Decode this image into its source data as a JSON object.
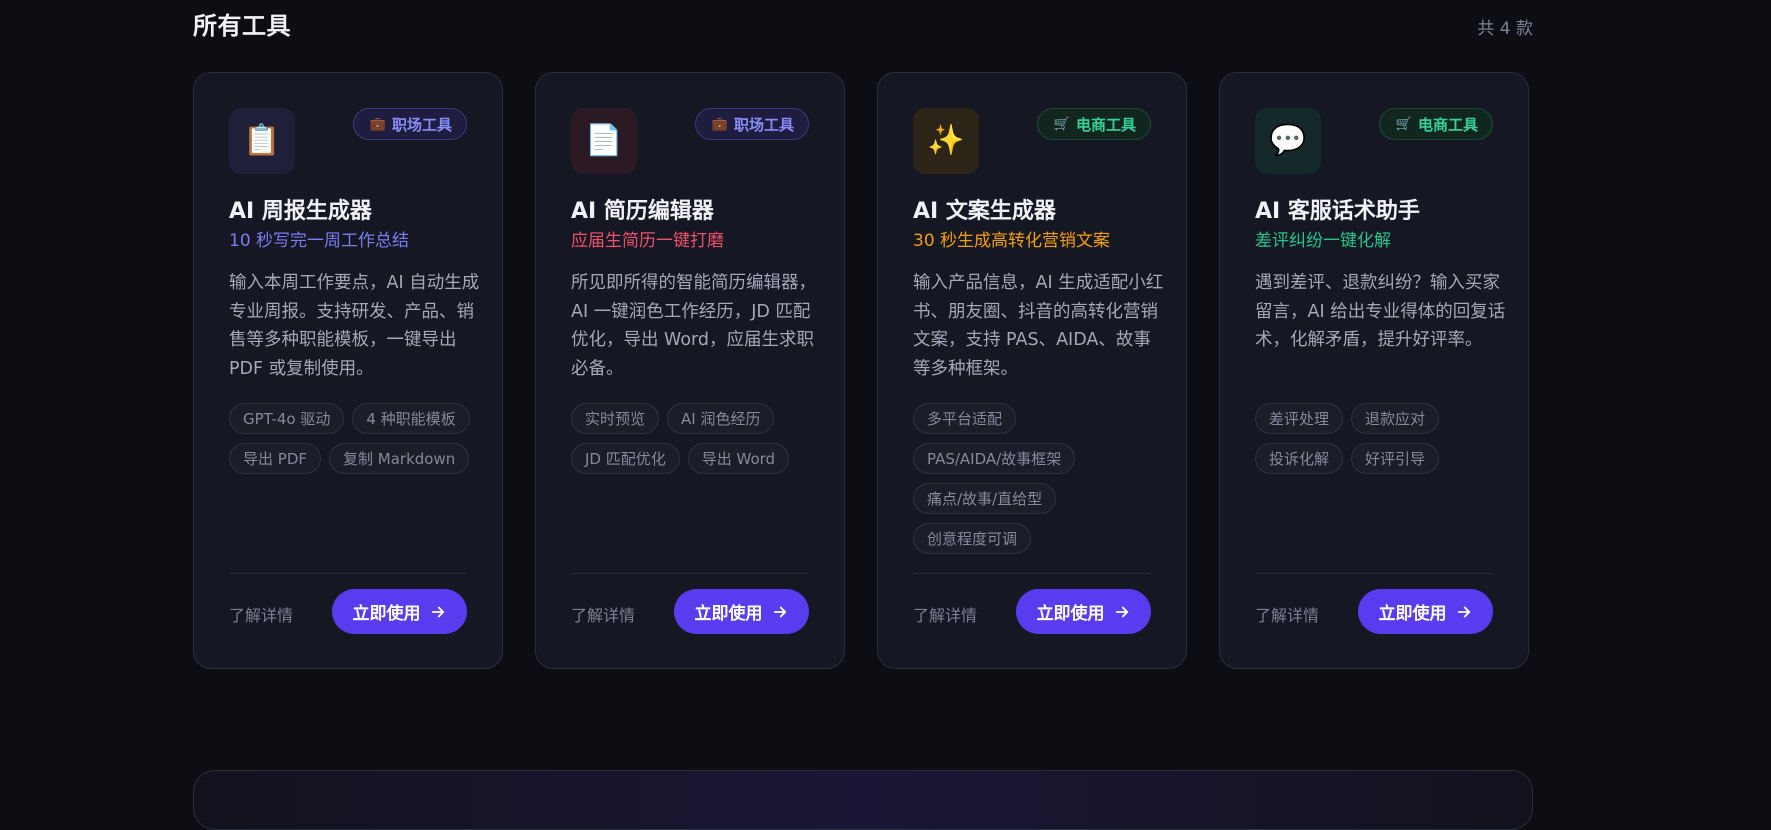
{
  "section": {
    "title": "所有工具",
    "count": "共 4 款"
  },
  "cards": [
    {
      "icon": "📋",
      "icon_name": "clipboard-icon",
      "icon_bg": "#1f1f3a",
      "badge": {
        "icon": "💼",
        "icon_name": "briefcase-icon",
        "label": "职场工具",
        "color": "#8b8cf7"
      },
      "title": "AI 周报生成器",
      "subtitle": "10 秒写完一周工作总结",
      "subtitle_color": "#7c7cf5",
      "description": "输入本周工作要点，AI 自动生成专业周报。支持研发、产品、销售等多种职能模板，一键导出 PDF 或复制使用。",
      "tags": [
        "GPT-4o 驱动",
        "4 种职能模板",
        "导出 PDF",
        "复制 Markdown"
      ],
      "learn_more": "了解详情",
      "cta": "立即使用"
    },
    {
      "icon": "📄",
      "icon_name": "document-icon",
      "icon_bg": "#2b1a24",
      "badge": {
        "icon": "💼",
        "icon_name": "briefcase-icon",
        "label": "职场工具",
        "color": "#8b8cf7"
      },
      "title": "AI 简历编辑器",
      "subtitle": "应届生简历一键打磨",
      "subtitle_color": "#f0506e",
      "description": "所见即所得的智能简历编辑器，AI 一键润色工作经历，JD 匹配优化，导出 Word，应届生求职必备。",
      "tags": [
        "实时预览",
        "AI 润色经历",
        "JD 匹配优化",
        "导出 Word"
      ],
      "learn_more": "了解详情",
      "cta": "立即使用"
    },
    {
      "icon": "✨",
      "icon_name": "sparkles-icon",
      "icon_bg": "#2d2418",
      "badge": {
        "icon": "🛒",
        "icon_name": "shopping-cart-icon",
        "label": "电商工具",
        "color": "#34d399"
      },
      "title": "AI 文案生成器",
      "subtitle": "30 秒生成高转化营销文案",
      "subtitle_color": "#f59e0b",
      "description": "输入产品信息，AI 生成适配小红书、朋友圈、抖音的高转化营销文案，支持 PAS、AIDA、故事等多种框架。",
      "tags": [
        "多平台适配",
        "PAS/AIDA/故事框架",
        "痛点/故事/直给型",
        "创意程度可调"
      ],
      "learn_more": "了解详情",
      "cta": "立即使用"
    },
    {
      "icon": "💬",
      "icon_name": "speech-bubble-icon",
      "icon_bg": "#15282a",
      "badge": {
        "icon": "🛒",
        "icon_name": "shopping-cart-icon",
        "label": "电商工具",
        "color": "#34d399"
      },
      "title": "AI 客服话术助手",
      "subtitle": "差评纠纷一键化解",
      "subtitle_color": "#22c58b",
      "description": "遇到差评、退款纠纷？输入买家留言，AI 给出专业得体的回复话术，化解矛盾，提升好评率。",
      "tags": [
        "差评处理",
        "退款应对",
        "投诉化解",
        "好评引导"
      ],
      "learn_more": "了解详情",
      "cta": "立即使用"
    }
  ]
}
